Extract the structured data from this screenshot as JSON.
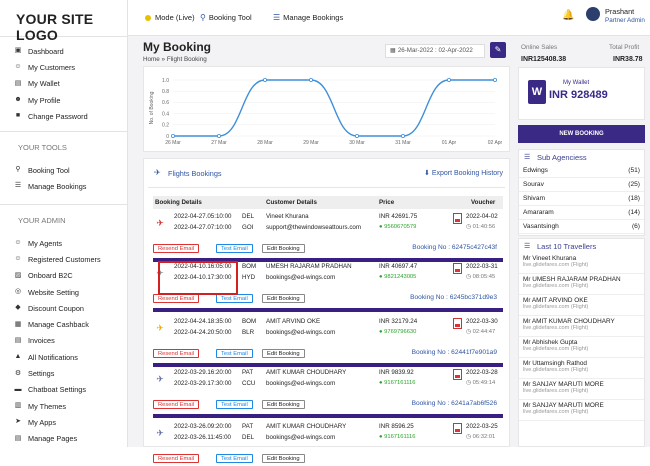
{
  "logo": "YOUR SITE LOGO",
  "topbar": {
    "mode": "Mode (Live)",
    "booking_tool": "Booking Tool",
    "manage_bookings": "Manage Bookings",
    "user_name": "Prashant",
    "user_role": "Partner Admin"
  },
  "sidebar": {
    "main_items": [
      {
        "label": "Dashboard",
        "icon": "dashboard-icon"
      },
      {
        "label": "My Customers",
        "icon": "users-icon"
      },
      {
        "label": "My Wallet",
        "icon": "wallet-icon"
      },
      {
        "label": "My Profile",
        "icon": "user-icon"
      },
      {
        "label": "Change Password",
        "icon": "lock-icon"
      }
    ],
    "tools_title": "YOUR TOOLS",
    "tools_items": [
      {
        "label": "Booking Tool",
        "icon": "search-icon"
      },
      {
        "label": "Manage Bookings",
        "icon": "list-icon"
      }
    ],
    "admin_title": "YOUR ADMIN",
    "admin_items": [
      {
        "label": "My Agents",
        "icon": "agents-icon"
      },
      {
        "label": "Registered Customers",
        "icon": "users-icon"
      },
      {
        "label": "Onboard B2C",
        "icon": "onboard-icon"
      },
      {
        "label": "Website Setting",
        "icon": "globe-icon"
      },
      {
        "label": "Discount Coupon",
        "icon": "coupon-icon"
      },
      {
        "label": "Manage Cashback",
        "icon": "cashback-icon"
      },
      {
        "label": "Invoices",
        "icon": "invoice-icon"
      },
      {
        "label": "All Notifications",
        "icon": "bell-icon"
      },
      {
        "label": "Settings",
        "icon": "gear-icon"
      },
      {
        "label": "Chatboat Settings",
        "icon": "chat-icon"
      },
      {
        "label": "My Themes",
        "icon": "theme-icon"
      },
      {
        "label": "My Apps",
        "icon": "send-icon"
      },
      {
        "label": "Manage Pages",
        "icon": "pages-icon"
      }
    ]
  },
  "page": {
    "title": "My Booking",
    "breadcrumb_home": "Home",
    "breadcrumb_sep": "»",
    "breadcrumb_current": "Flight Booking",
    "date_range": "26-Mar-2022 : 02-Apr-2022"
  },
  "chart_data": {
    "type": "line",
    "x": [
      "26 Mar",
      "27 Mar",
      "28 Mar",
      "29 Mar",
      "30 Mar",
      "31 Mar",
      "01 Apr",
      "02 Apr"
    ],
    "values": [
      0,
      0,
      1,
      1,
      0,
      0,
      1,
      1
    ],
    "ylabel": "No. of Booking",
    "ylim": [
      0,
      1
    ],
    "yticks": [
      "0",
      "0.2",
      "0.4",
      "0.6",
      "0.8",
      "1.0"
    ],
    "color": "#3f8fd8"
  },
  "bookings_panel": {
    "title": "Flights Bookings",
    "export": "Export Booking History",
    "headers": {
      "details": "Booking Details",
      "customer": "Customer Details",
      "price": "Price",
      "voucher": "Voucher"
    },
    "buttons": {
      "resend": "Resend Email",
      "test": "Test Email",
      "edit": "Edit Booking"
    },
    "booking_prefix": "Booking No : ",
    "rows": [
      {
        "dep": "2022-04-27.05:10:00",
        "arr": "2022-04-27.07:10:00",
        "from": "DEL",
        "to": "GOI",
        "name": "Vineet Khurana",
        "email": "support@thewindowseattours.com",
        "price": "INR 42691.75",
        "phone": "9560670579",
        "vdate": "2022-04-02",
        "vtime": "01:40:56",
        "booking": "62475c427c43f",
        "airline_color": "#d32f2f",
        "airline_icon": "airasia-icon"
      },
      {
        "dep": "2022-04-10.16:05:00",
        "arr": "2022-04-10.17:30:00",
        "from": "BOM",
        "to": "HYD",
        "name": "UMESH RAJARAM PRADHAN",
        "email": "bookings@ed-wings.com",
        "price": "INR 40697.47",
        "phone": "9821243005",
        "vdate": "2022-03-31",
        "vtime": "08:05:45",
        "booking": "6245bc371d9e3",
        "airline_color": "#888888",
        "airline_icon": "plane-icon"
      },
      {
        "dep": "2022-04-24.18:35:00",
        "arr": "2022-04-24.20:50:00",
        "from": "BOM",
        "to": "BLR",
        "name": "AMIT ARVIND OKE",
        "email": "bookings@ed-wings.com",
        "price": "INR 32179.24",
        "phone": "9769796630",
        "vdate": "2022-03-30",
        "vtime": "02:44:47",
        "booking": "62441f7e901a9",
        "airline_color": "#f2a900",
        "airline_icon": "vistara-icon"
      },
      {
        "dep": "2022-03-29.16:20:00",
        "arr": "2022-03-29.17:30:00",
        "from": "PAT",
        "to": "CCU",
        "name": "AMIT KUMAR CHOUDHARY",
        "email": "bookings@ed-wings.com",
        "price": "INR 9839.92",
        "phone": "9167161116",
        "vdate": "2022-03-28",
        "vtime": "05:49:14",
        "booking": "6241a7ab6f526",
        "airline_color": "#5b6ea8",
        "airline_icon": "plane-icon"
      },
      {
        "dep": "2022-03-26.09:20:00",
        "arr": "2022-03-26.11:45:00",
        "from": "PAT",
        "to": "DEL",
        "name": "AMIT KUMAR CHOUDHARY",
        "email": "bookings@ed-wings.com",
        "price": "INR 8596.25",
        "phone": "9167161116",
        "vdate": "2022-03-25",
        "vtime": "06:32:01",
        "booking": "",
        "airline_color": "#5b6ea8",
        "airline_icon": "plane-icon"
      }
    ]
  },
  "right": {
    "online_sales_label": "Online Sales",
    "online_sales_value": "INR125408.38",
    "total_profit_label": "Total Profit",
    "total_profit_value": "INR38.78",
    "wallet_label": "My Wallet",
    "wallet_value": "INR 928489",
    "new_booking": "NEW BOOKING",
    "sub_agencies_title": "Sub Agenciess",
    "sub_agencies": [
      {
        "name": "Edwings",
        "count": "(51)"
      },
      {
        "name": "Sourav",
        "count": "(25)"
      },
      {
        "name": "Shivam",
        "count": "(18)"
      },
      {
        "name": "Amararam",
        "count": "(14)"
      },
      {
        "name": "Vasantsingh",
        "count": "(6)"
      }
    ],
    "travellers_title": "Last 10 Travellers",
    "travellers": [
      {
        "name": "Mr Vineet Khurana",
        "site": "live.glidefares.com (Flight)"
      },
      {
        "name": "Mr UMESH RAJARAM PRADHAN",
        "site": "live.glidefares.com (Flight)"
      },
      {
        "name": "Mr AMIT ARVIND OKE",
        "site": "live.glidefares.com (Flight)"
      },
      {
        "name": "Mr AMIT KUMAR CHOUDHARY",
        "site": "live.glidefares.com (Flight)"
      },
      {
        "name": "Mr Abhishek Gupta",
        "site": "live.glidefares.com (Flight)"
      },
      {
        "name": "Mr Uttamsingh Rathod",
        "site": "live.glidefares.com (Flight)"
      },
      {
        "name": "Mr SANJAY MARUTI MORE",
        "site": "live.glidefares.com (Flight)"
      },
      {
        "name": "Mr SANJAY MARUTI MORE",
        "site": "live.glidefares.com (Flight)"
      }
    ]
  }
}
